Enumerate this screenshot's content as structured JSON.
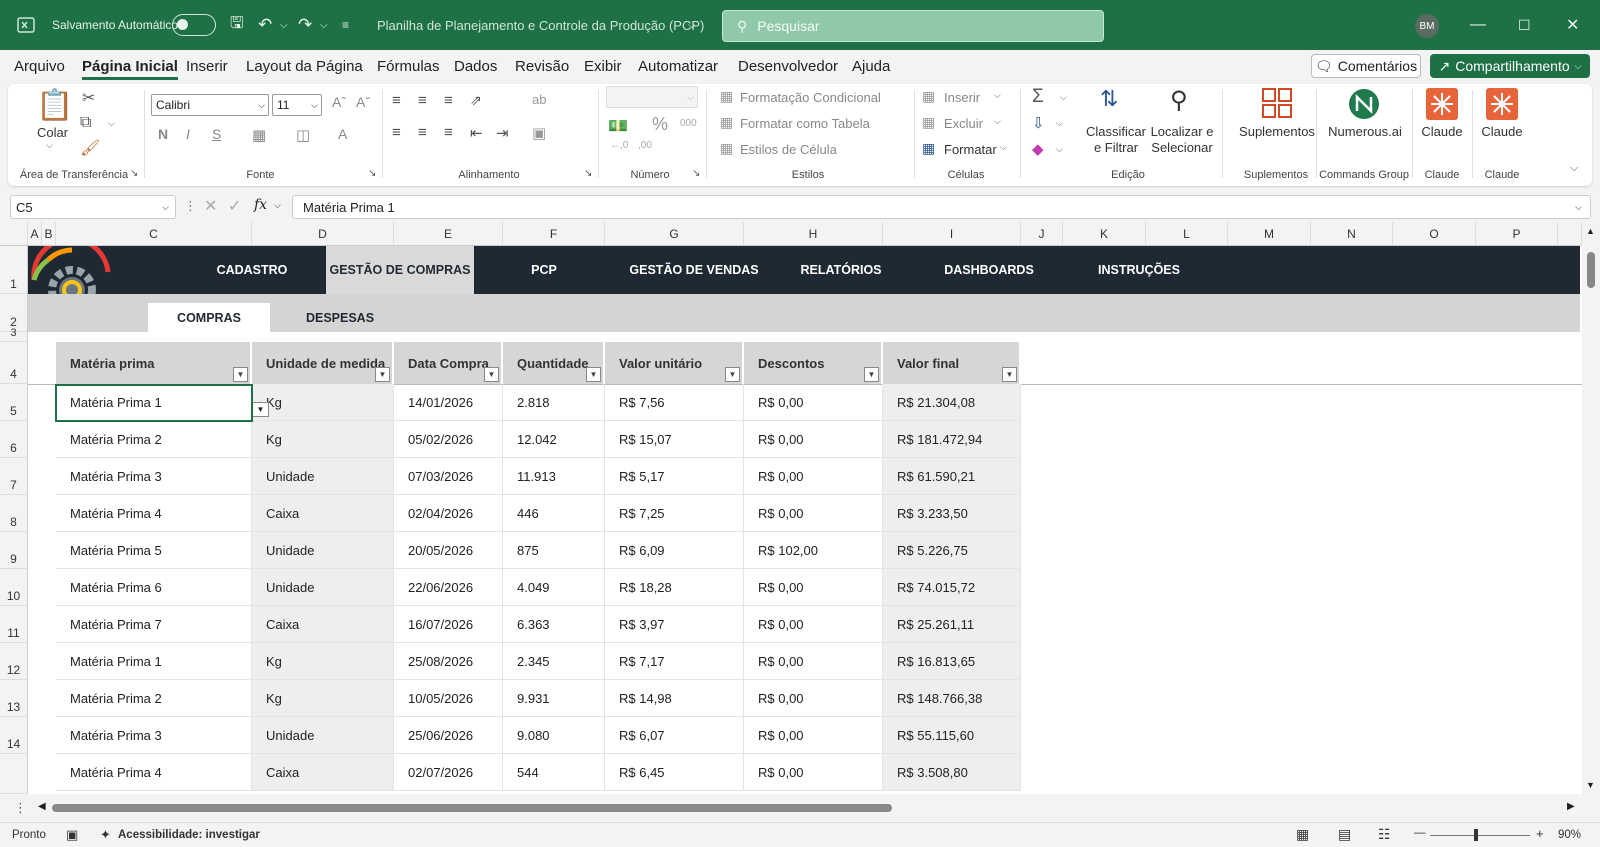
{
  "titlebar": {
    "autosave_label": "Salvamento Automático",
    "doc_title": "Planilha de Planejamento e Controle da Produção (PCP)",
    "search_placeholder": "Pesquisar",
    "user_initials": "BM"
  },
  "menu": {
    "items": [
      "Arquivo",
      "Página Inicial",
      "Inserir",
      "Layout da Página",
      "Fórmulas",
      "Dados",
      "Revisão",
      "Exibir",
      "Automatizar",
      "Desenvolvedor",
      "Ajuda"
    ],
    "active": "Página Inicial",
    "comments_label": "Comentários",
    "share_label": "Compartilhamento"
  },
  "ribbon": {
    "clipboard": {
      "paste": "Colar",
      "label": "Área de Transferência"
    },
    "font": {
      "name": "Calibri",
      "size": "11",
      "label": "Fonte"
    },
    "alignment": {
      "label": "Alinhamento"
    },
    "number": {
      "label": "Número"
    },
    "styles": {
      "conditional": "Formatação Condicional",
      "table": "Formatar como Tabela",
      "cell": "Estilos de Célula",
      "label": "Estilos"
    },
    "cells": {
      "insert": "Inserir",
      "delete": "Excluir",
      "format": "Formatar",
      "label": "Células"
    },
    "editing": {
      "sort1": "Classificar",
      "sort2": "e Filtrar",
      "find1": "Localizar e",
      "find2": "Selecionar",
      "label": "Edição"
    },
    "addins": {
      "button": "Suplementos",
      "label": "Suplementos"
    },
    "numerous": {
      "button": "Numerous.ai",
      "label": "Commands Group"
    },
    "claude1": {
      "button": "Claude",
      "label": "Claude"
    },
    "claude2": {
      "button": "Claude",
      "label": "Claude"
    }
  },
  "formula": {
    "cell_ref": "C5",
    "fx": "fx",
    "value": "Matéria Prima 1"
  },
  "columns": [
    "A",
    "B",
    "C",
    "D",
    "E",
    "F",
    "G",
    "H",
    "I",
    "J",
    "K",
    "L",
    "M",
    "N",
    "O",
    "P"
  ],
  "rows": [
    "1",
    "2",
    "3",
    "4",
    "5",
    "6",
    "7",
    "8",
    "9",
    "10",
    "11",
    "12",
    "13",
    "14"
  ],
  "nav": {
    "tabs": [
      "CADASTRO",
      "GESTÃO DE COMPRAS",
      "PCP",
      "GESTÃO DE VENDAS",
      "RELATÓRIOS",
      "DASHBOARDS",
      "INSTRUÇÕES"
    ],
    "active": "GESTÃO DE COMPRAS",
    "subtabs": [
      "COMPRAS",
      "DESPESAS"
    ],
    "sub_active": "COMPRAS"
  },
  "table": {
    "headers": [
      "Matéria prima",
      "Unidade de medida",
      "Data Compra",
      "Quantidade",
      "Valor unitário",
      "Descontos",
      "Valor final"
    ],
    "rows": [
      [
        "Matéria Prima 1",
        "Kg",
        "14/01/2026",
        "2.818",
        "R$ 7,56",
        "R$ 0,00",
        "R$ 21.304,08"
      ],
      [
        "Matéria Prima 2",
        "Kg",
        "05/02/2026",
        "12.042",
        "R$ 15,07",
        "R$ 0,00",
        "R$ 181.472,94"
      ],
      [
        "Matéria Prima 3",
        "Unidade",
        "07/03/2026",
        "11.913",
        "R$ 5,17",
        "R$ 0,00",
        "R$ 61.590,21"
      ],
      [
        "Matéria Prima 4",
        "Caixa",
        "02/04/2026",
        "446",
        "R$ 7,25",
        "R$ 0,00",
        "R$ 3.233,50"
      ],
      [
        "Matéria Prima 5",
        "Unidade",
        "20/05/2026",
        "875",
        "R$ 6,09",
        "R$ 102,00",
        "R$ 5.226,75"
      ],
      [
        "Matéria Prima 6",
        "Unidade",
        "22/06/2026",
        "4.049",
        "R$ 18,28",
        "R$ 0,00",
        "R$ 74.015,72"
      ],
      [
        "Matéria Prima 7",
        "Caixa",
        "16/07/2026",
        "6.363",
        "R$ 3,97",
        "R$ 0,00",
        "R$ 25.261,11"
      ],
      [
        "Matéria Prima 1",
        "Kg",
        "25/08/2026",
        "2.345",
        "R$ 7,17",
        "R$ 0,00",
        "R$ 16.813,65"
      ],
      [
        "Matéria Prima 2",
        "Kg",
        "10/05/2026",
        "9.931",
        "R$ 14,98",
        "R$ 0,00",
        "R$ 148.766,38"
      ],
      [
        "Matéria Prima 3",
        "Unidade",
        "25/06/2026",
        "9.080",
        "R$ 6,07",
        "R$ 0,00",
        "R$ 55.115,60"
      ],
      [
        "Matéria Prima 4",
        "Caixa",
        "02/07/2026",
        "544",
        "R$ 6,45",
        "R$ 0,00",
        "R$ 3.508,80"
      ]
    ]
  },
  "status": {
    "ready": "Pronto",
    "accessibility": "Acessibilidade: investigar",
    "zoom": "90%"
  },
  "colors": {
    "excel_green": "#1e7145",
    "nav_dark": "#1f2933"
  }
}
